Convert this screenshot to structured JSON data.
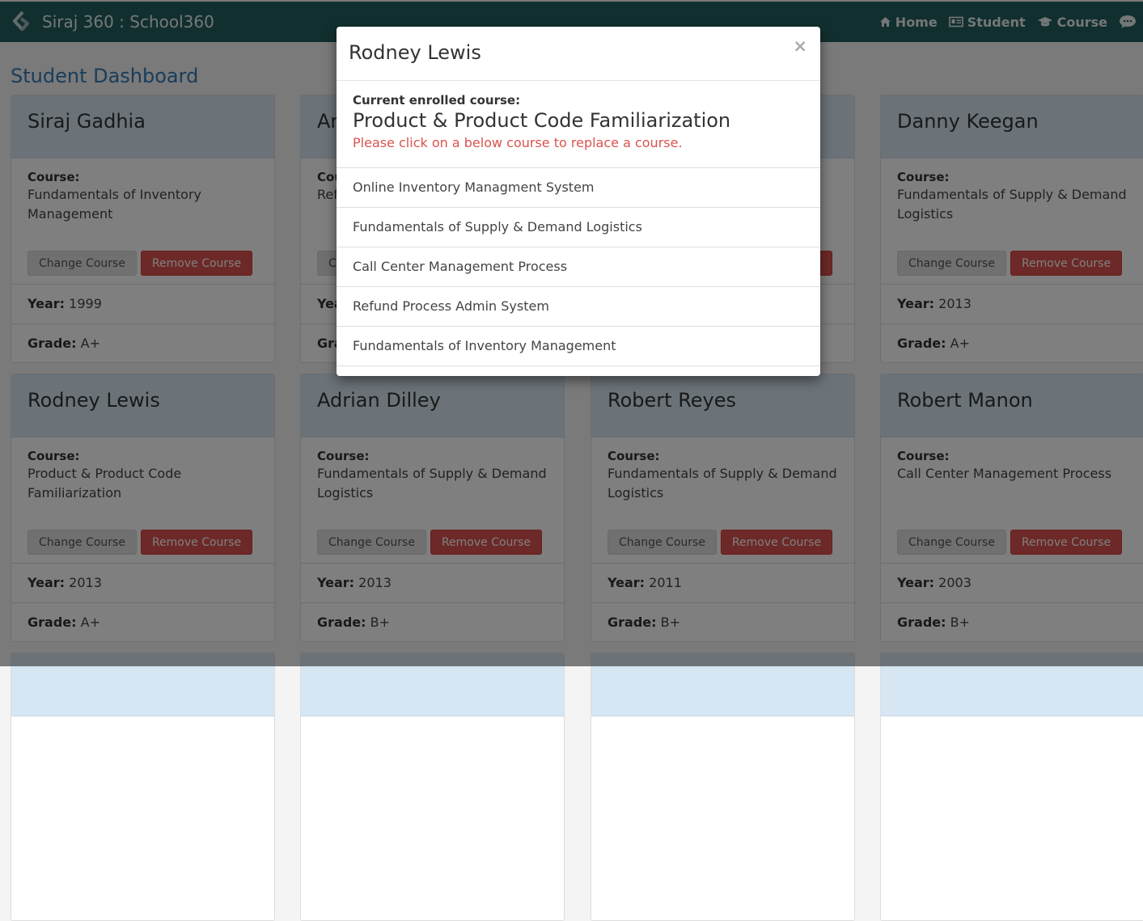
{
  "nav": {
    "brand": "Siraj 360 : School360",
    "links": [
      "Home",
      "Student",
      "Course"
    ]
  },
  "page": {
    "title": "Student Dashboard"
  },
  "labels": {
    "course": "Course:",
    "year": "Year:",
    "grade": "Grade:",
    "change_button": "Change Course",
    "remove_button": "Remove Course"
  },
  "students": [
    {
      "name": "Siraj Gadhia",
      "course": "Fundamentals of Inventory Management",
      "year": "1999",
      "grade": "A+"
    },
    {
      "name": "An",
      "course": "Ref",
      "year": "",
      "grade": ""
    },
    {
      "name": "",
      "course": "",
      "year": "",
      "grade": ""
    },
    {
      "name": "Danny Keegan",
      "course": "Fundamentals of Supply & Demand Logistics",
      "year": "2013",
      "grade": "A+"
    },
    {
      "name": "Rodney Lewis",
      "course": "Product & Product Code Familiarization",
      "year": "2013",
      "grade": "A+"
    },
    {
      "name": "Adrian Dilley",
      "course": "Fundamentals of Supply & Demand Logistics",
      "year": "2013",
      "grade": "B+"
    },
    {
      "name": "Robert Reyes",
      "course": "Fundamentals of Supply & Demand Logistics",
      "year": "2011",
      "grade": "B+"
    },
    {
      "name": "Robert Manon",
      "course": "Call Center Management Process",
      "year": "2003",
      "grade": "B+"
    }
  ],
  "modal": {
    "title": "Rodney Lewis",
    "close": "×",
    "enrolled_label": "Current enrolled course:",
    "enrolled_course": "Product & Product Code Familiarization",
    "hint": "Please click on a below course to replace a course.",
    "options": [
      "Online Inventory Managment System",
      "Fundamentals of Supply & Demand Logistics",
      "Call Center Management Process",
      "Refund Process Admin System",
      "Fundamentals of Inventory Management"
    ]
  }
}
